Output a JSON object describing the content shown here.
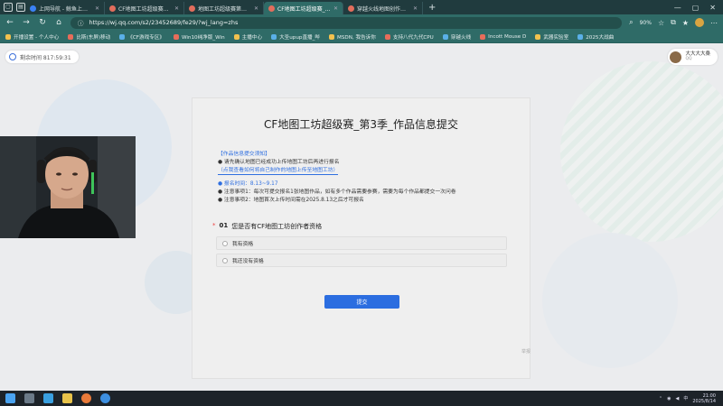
{
  "browser": {
    "tabs": [
      {
        "label": "上网导航 - 鲸鱼上网 从这里开始",
        "active": false
      },
      {
        "label": "CF地图工坊超级赛第三季 王者",
        "active": false
      },
      {
        "label": "地图工坊超级赛第三季·穿越火线",
        "active": false
      },
      {
        "label": "CF地图工坊超级赛_第3季_作品信息提交",
        "active": true
      },
      {
        "label": "穿越火线地图创作者中心-腾讯游戏",
        "active": false
      }
    ],
    "new_tab": "+",
    "url": "https://wj.qq.com/s2/23452689/fe29/?wj_lang=zhs",
    "zoom": "90%",
    "bookmarks": [
      "开播设置 - 个人中心",
      "比斯(东屏)移动",
      "《CF游戏专区》",
      "Win10纯净版_Win",
      "主播中心",
      "大圣upup直播_哔",
      "MSDN, 我告诉你",
      "支持八代九代CPU",
      "穿越火线",
      "Incott Mouse D",
      "武器实验室",
      "2025大战曲"
    ]
  },
  "timer": {
    "label": "剩余时间 817:59:31"
  },
  "user": {
    "name": "大大大大桑",
    "sub": "QQ"
  },
  "form": {
    "title": "CF地图工坊超级赛_第3季_作品信息提交",
    "notice_heading": "【作品信息提交须知】",
    "notice_line1": "● 请先确认地图已经成功上传地图工坊后再进行报名",
    "notice_link": "（点我查看如何将自己制作的地图上传至地图工坊）",
    "period": "● 报名时间：8.13~9.17",
    "note1": "● 注意事项1：每次可提交报名1张地图作品，如有多个作品需要参赛，需要为每个作品都提交一次问卷",
    "note2": "● 注意事项2：地图首次上传时间需在2025.8.13之后才可报名",
    "question_required": "*",
    "question_number": "01",
    "question_text": "您是否有CF地图工坊创作者资格",
    "options": [
      "我有资格",
      "我还没有资格"
    ],
    "submit_label": "提交",
    "report_label": "举报"
  },
  "taskbar": {
    "time": "21:00",
    "date": "2025/8/14",
    "lang": "中"
  }
}
